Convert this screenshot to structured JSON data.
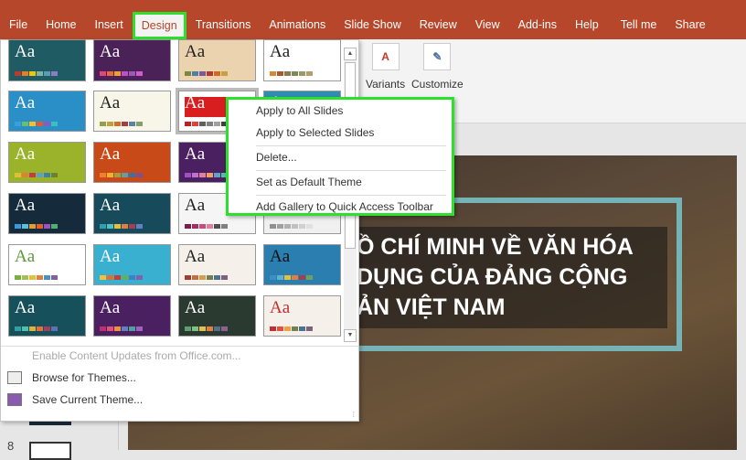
{
  "ribbon_tabs": [
    "File",
    "Home",
    "Insert",
    "Design",
    "Transitions",
    "Animations",
    "Slide Show",
    "Review",
    "View",
    "Add-ins",
    "Help",
    "Tell me",
    "Share"
  ],
  "active_tab": "Design",
  "ribbon_buttons": {
    "variants": "Variants",
    "customize": "Customize"
  },
  "theme_label": "Aa",
  "themes": [
    {
      "bg": "#1f5b62",
      "fg": "#fff",
      "sw": [
        "#c0392b",
        "#e67e22",
        "#f1c40f",
        "#7fb3a6",
        "#5d9cb0",
        "#8e7cc3"
      ]
    },
    {
      "bg": "#4b2257",
      "fg": "#fff",
      "sw": [
        "#e0457b",
        "#e86a3a",
        "#f0a030",
        "#c150c0",
        "#9b59b6",
        "#d05cd0"
      ]
    },
    {
      "bg": "#ecd3b0",
      "fg": "#222",
      "sw": [
        "#7a8a3c",
        "#4e7fa8",
        "#7a5a9a",
        "#b03a2e",
        "#d06a28",
        "#c8a040"
      ]
    },
    {
      "bg": "#ffffff",
      "fg": "#222",
      "sw": [
        "#d08a3a",
        "#a65a30",
        "#8a7a50",
        "#7a8a5a",
        "#9a9a6a",
        "#b0a070"
      ]
    },
    {
      "bg": "#2a8fc6",
      "fg": "#fff",
      "sw": [
        "#3aa0d8",
        "#6ac06a",
        "#f0c030",
        "#e05a3a",
        "#8a5ac0",
        "#3ac0c0"
      ]
    },
    {
      "bg": "#f7f6e8",
      "fg": "#222",
      "sw": [
        "#90a050",
        "#c0a040",
        "#d07030",
        "#a04040",
        "#6080a0",
        "#80a070"
      ]
    },
    {
      "bg": "#ffffff",
      "fg": "#fff",
      "sw": [
        "#c02020",
        "#e04040",
        "#606060",
        "#808080",
        "#a0a0a0",
        "#404040"
      ]
    },
    {
      "bg": "#2d8fb0",
      "fg": "#fff",
      "sw": [
        "#40a0c0",
        "#60c0a0",
        "#f0c040",
        "#e08040",
        "#c05050",
        "#8060a0"
      ]
    },
    {
      "bg": "#9ab32a",
      "fg": "#fff",
      "sw": [
        "#e0c030",
        "#e08030",
        "#c04040",
        "#60a0c0",
        "#4080a0",
        "#708030"
      ]
    },
    {
      "bg": "#c84a18",
      "fg": "#fff",
      "sw": [
        "#f08030",
        "#f0b030",
        "#a0a040",
        "#60a0a0",
        "#4070a0",
        "#805090"
      ]
    },
    {
      "bg": "#4a2060",
      "fg": "#fff",
      "sw": [
        "#a050c0",
        "#c070d0",
        "#e080a0",
        "#f0a060",
        "#60a0d0",
        "#50c0a0"
      ]
    },
    {
      "bg": "#2f6f8a",
      "fg": "#fff",
      "sw": [
        "#40a0c0",
        "#70c0d0",
        "#e0a040",
        "#c05040",
        "#8060a0",
        "#60a060"
      ]
    },
    {
      "bg": "#152a3a",
      "fg": "#fff",
      "sw": [
        "#3a9ad9",
        "#5ac0e0",
        "#e0a030",
        "#e06030",
        "#a050c0",
        "#50b070"
      ]
    },
    {
      "bg": "#174a5a",
      "fg": "#fff",
      "sw": [
        "#30a0b0",
        "#50c0c0",
        "#e0c040",
        "#e08040",
        "#a04050",
        "#6080c0"
      ]
    },
    {
      "bg": "#f5f5f5",
      "fg": "#222",
      "sw": [
        "#7a2050",
        "#a03060",
        "#c05080",
        "#e080a0",
        "#505050",
        "#808080"
      ]
    },
    {
      "bg": "#f0f0f0",
      "fg": "#222",
      "sw": [
        "#909090",
        "#a0a0a0",
        "#b0b0b0",
        "#c0c0c0",
        "#d0d0d0",
        "#e0e0e0"
      ]
    },
    {
      "bg": "#ffffff",
      "fg": "#5a9a3a",
      "sw": [
        "#7ab040",
        "#a0c050",
        "#e0c040",
        "#e08040",
        "#4a90c0",
        "#8060a0"
      ]
    },
    {
      "bg": "#3ab0d0",
      "fg": "#fff",
      "sw": [
        "#f0c040",
        "#e07030",
        "#c04040",
        "#60b060",
        "#4080c0",
        "#8060b0"
      ]
    },
    {
      "bg": "#f5f0ea",
      "fg": "#222",
      "sw": [
        "#a04030",
        "#c07040",
        "#d0a050",
        "#708050",
        "#507090",
        "#806080"
      ]
    },
    {
      "bg": "#2a7fb0",
      "fg": "#111",
      "sw": [
        "#3a90c0",
        "#60b0d0",
        "#e0c040",
        "#e08040",
        "#a04050",
        "#70a060"
      ]
    },
    {
      "bg": "#16505a",
      "fg": "#fff",
      "sw": [
        "#30a0a0",
        "#50c0b0",
        "#e0b040",
        "#e07040",
        "#a04060",
        "#6070b0"
      ]
    },
    {
      "bg": "#4a2060",
      "fg": "#fff",
      "sw": [
        "#c03070",
        "#e05080",
        "#f09040",
        "#6080c0",
        "#50a0a0",
        "#a060c0"
      ]
    },
    {
      "bg": "#2a3a30",
      "fg": "#fff",
      "sw": [
        "#60a070",
        "#80c080",
        "#e0c050",
        "#e08040",
        "#507090",
        "#906090"
      ]
    },
    {
      "bg": "#f5f0ea",
      "fg": "#c03030",
      "sw": [
        "#c03030",
        "#e05040",
        "#f0a040",
        "#708050",
        "#507090",
        "#806080"
      ]
    }
  ],
  "panel_items": [
    {
      "label": "Enable Content Updates from Office.com...",
      "disabled": true
    },
    {
      "label": "Browse for Themes...",
      "disabled": false
    },
    {
      "label": "Save Current Theme...",
      "disabled": false
    }
  ],
  "context_menu": [
    "Apply to All Slides",
    "Apply to Selected Slides",
    "Delete...",
    "Set as Default Theme",
    "Add Gallery to Quick Access Toolbar"
  ],
  "slide": {
    "title_lines": [
      "Ồ CHÍ MINH VỀ VĂN HÓA",
      "DỤNG CỦA ĐẢNG CỘNG",
      "ẢN VIỆT NAM"
    ]
  },
  "sidebar": {
    "slide_number": "8"
  },
  "colors": {
    "ribbon": "#b7472a",
    "highlight": "#2de02d"
  }
}
